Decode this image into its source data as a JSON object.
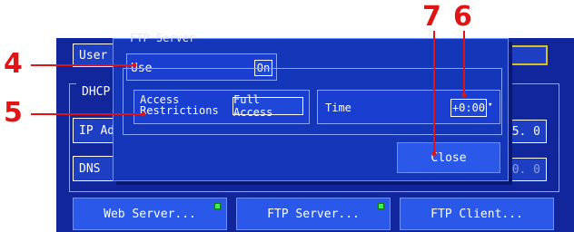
{
  "background": {
    "user_field_label": "User N",
    "dhcp_label": "DHCP",
    "ip_field_label": "IP Ad",
    "ip_value_tail": "5.  0",
    "dns_label": "DNS",
    "dns_value_tail": "0.  0"
  },
  "bottom_buttons": {
    "web_server": "Web Server...",
    "ftp_server": "FTP Server...",
    "ftp_client": "FTP Client..."
  },
  "dialog": {
    "title": "FTP Server",
    "use_label": "Use",
    "use_value": "On",
    "access_label_line1": "Access",
    "access_label_line2": "Restrictions",
    "access_value": "Full Access",
    "time_label": "Time",
    "time_value": "+0:00",
    "close_label": "Close"
  },
  "callouts": {
    "c4": "4",
    "c5": "5",
    "c6": "6",
    "c7": "7"
  },
  "colors": {
    "screen_bg": "#10269a",
    "callout_red": "#e01414",
    "led_green": "#2dff3a"
  }
}
